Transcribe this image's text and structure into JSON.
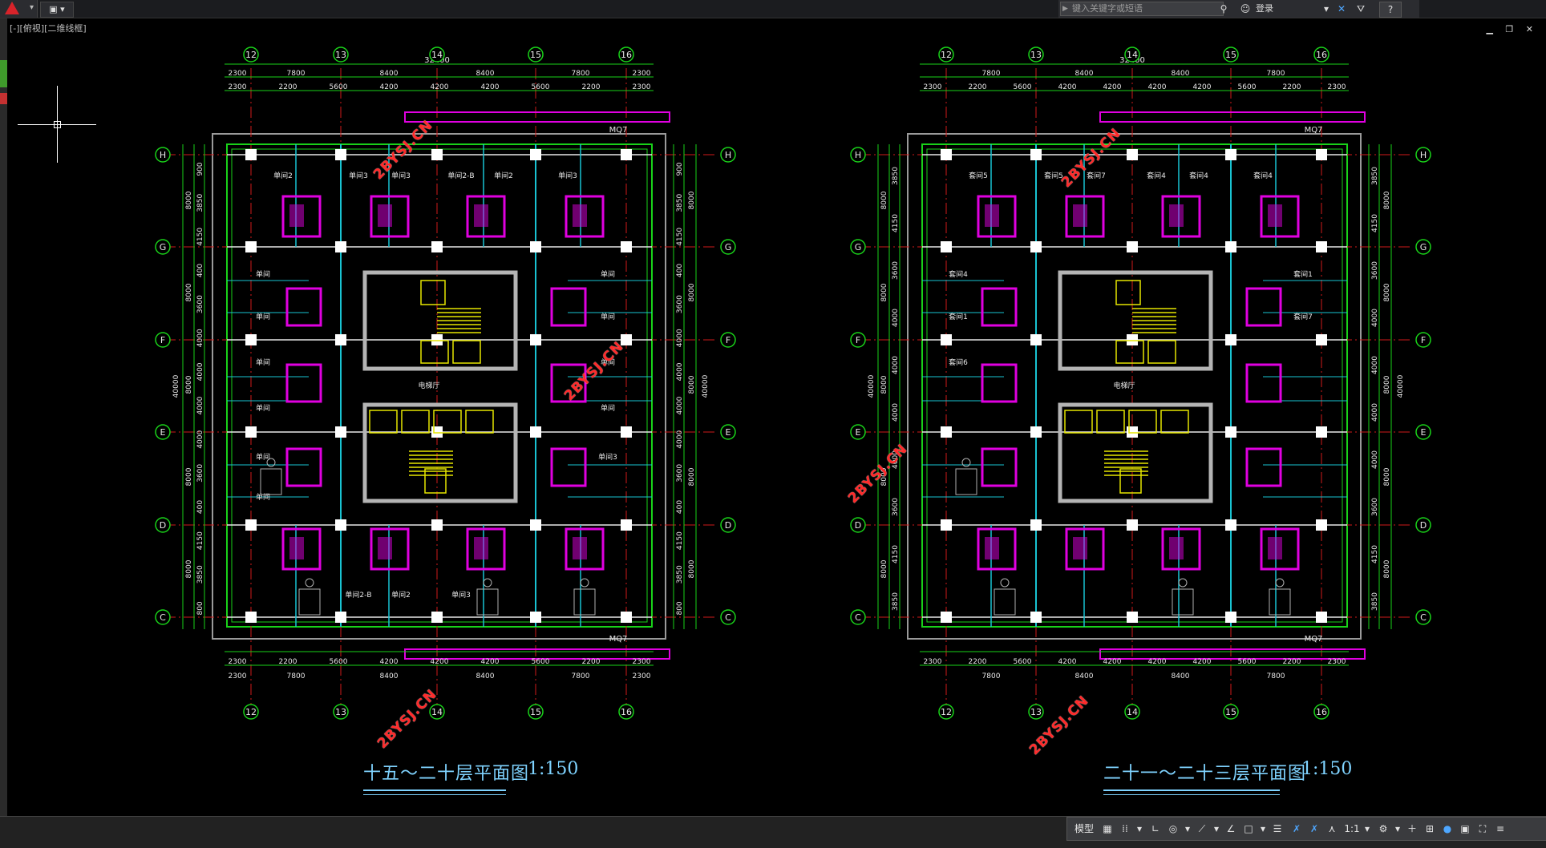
{
  "titlebar": {
    "qa_label": "▣ ▾",
    "search_placeholder": "键入关键字或短语",
    "login_label": "登录"
  },
  "viewport": {
    "label": "[-][俯视][二维线框]"
  },
  "drawing": {
    "left_plan": {
      "title": "十五～二十层平面图",
      "scale": "1:150",
      "column_axes": [
        "12",
        "13",
        "14",
        "15",
        "16"
      ],
      "row_axes": [
        "H",
        "G",
        "F",
        "E",
        "D",
        "C"
      ],
      "dim_total": "32400",
      "dim_row1": [
        "2300",
        "7800",
        "8400",
        "8400",
        "7800",
        "2300"
      ],
      "dim_row2": [
        "2300",
        "2200",
        "5600",
        "4200",
        "4200",
        "4200",
        "5600",
        "2200",
        "2300"
      ],
      "side_dims_left": [
        "900",
        "3850",
        "4150",
        "400",
        "3600",
        "4000",
        "4000",
        "4000",
        "4000",
        "3600",
        "400",
        "4150",
        "3850",
        "800"
      ],
      "side_total": "40000",
      "rooms": [
        "单间2",
        "单间3",
        "单间3",
        "单间2-B",
        "单间2",
        "单间3",
        "单间",
        "单间",
        "单间",
        "单间",
        "单间",
        "单间",
        "单间",
        "单间",
        "单间",
        "单间3",
        "单间",
        "单间2-B",
        "单间2",
        "单间3"
      ],
      "corridor_label": "电梯厅",
      "door_label_top": "MQ7",
      "door_label_bot": "MQ7"
    },
    "right_plan": {
      "title": "二十一～二十三层平面图",
      "scale": "1:150",
      "column_axes": [
        "12",
        "13",
        "14",
        "15",
        "16"
      ],
      "row_axes": [
        "H",
        "G",
        "F",
        "E",
        "D",
        "C"
      ],
      "dim_total": "32400",
      "dim_row1": [
        "7800",
        "8400",
        "8400",
        "7800"
      ],
      "dim_row2": [
        "2300",
        "2200",
        "5600",
        "4200",
        "4200",
        "4200",
        "4200",
        "5600",
        "2200",
        "2300"
      ],
      "side_total": "40000",
      "rooms": [
        "套间5",
        "套间5",
        "套间7",
        "套间4",
        "套间4",
        "套间4",
        "套间4",
        "套间1",
        "套间1",
        "套间7",
        "套间6"
      ],
      "corridor_label": "电梯厅",
      "door_label_top": "MQ7",
      "door_label_bot": "MQ7"
    },
    "watermark_text": "2BYSJ.CN"
  },
  "statusbar": {
    "model_label": "模型",
    "scale_label": "1:1"
  },
  "colors": {
    "grid_green": "#19d219",
    "wall_white": "#e8e8e8",
    "cyan": "#19c3d2",
    "magenta": "#e000e0",
    "axis_red": "#d11a1a",
    "title_cyan": "#7fd3ff",
    "yellow": "#e6e600"
  }
}
